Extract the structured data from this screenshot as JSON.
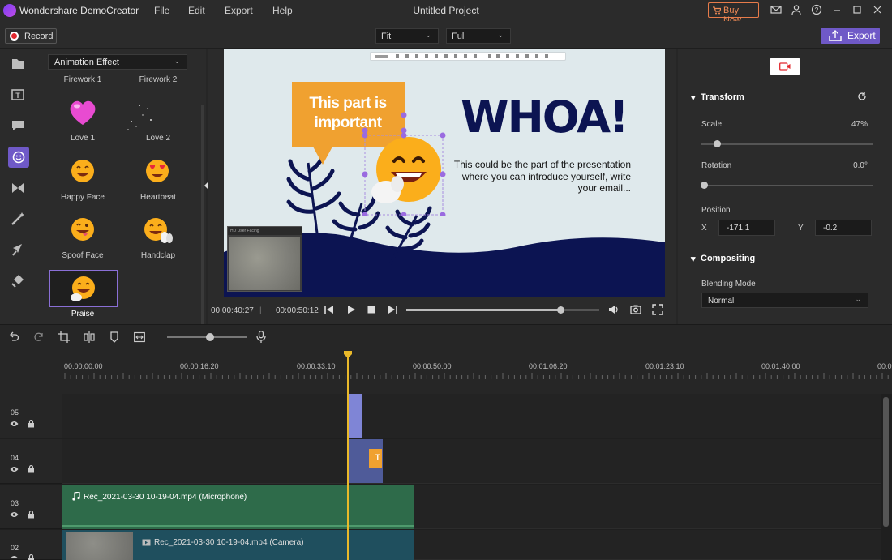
{
  "app": {
    "name": "Wondershare DemoCreator",
    "project_title": "Untitled Project",
    "menus": [
      "File",
      "Edit",
      "Export",
      "Help"
    ],
    "buy_now": "Buy Now"
  },
  "toolbar": {
    "record_label": "Record",
    "fit_value": "Fit",
    "full_value": "Full",
    "export_label": "Export"
  },
  "sidebar": {
    "icons": [
      "media-icon",
      "text-icon",
      "annotation-icon",
      "sticker-icon",
      "transition-icon",
      "effects-icon",
      "cursor-icon",
      "audio-icon"
    ],
    "active_index": 3
  },
  "effects_panel": {
    "category": "Animation Effect",
    "items": [
      {
        "label": "Firework 1"
      },
      {
        "label": "Firework 2"
      },
      {
        "label": "Love 1"
      },
      {
        "label": "Love 2"
      },
      {
        "label": "Happy Face"
      },
      {
        "label": "Heartbeat"
      },
      {
        "label": "Spoof Face"
      },
      {
        "label": "Handclap"
      },
      {
        "label": "Praise"
      }
    ],
    "selected": "Praise"
  },
  "canvas": {
    "callout": "This part is important",
    "headline": "WHOA!",
    "body": "This could be the part of the presentation where you can introduce yourself, write your email...",
    "webcam_title": "HD User Facing"
  },
  "playback": {
    "current_time": "00:00:40:27",
    "total_time": "00:00:50:12",
    "progress": 0.8
  },
  "properties": {
    "transform_label": "Transform",
    "scale_label": "Scale",
    "scale_value": "47%",
    "rotation_label": "Rotation",
    "rotation_value": "0.0°",
    "position_label": "Position",
    "x_label": "X",
    "x_value": "-171.1",
    "y_label": "Y",
    "y_value": "-0.2",
    "compositing_label": "Compositing",
    "blend_label": "Blending Mode",
    "blend_value": "Normal"
  },
  "timeline": {
    "ruler": [
      "00:00:00:00",
      "00:00:16:20",
      "00:00:33:10",
      "00:00:50:00",
      "00:01:06:20",
      "00:01:23:10",
      "00:01:40:00",
      "00:0"
    ],
    "tracks": [
      {
        "number": "05"
      },
      {
        "number": "04",
        "clip_text": "T"
      },
      {
        "number": "03",
        "clip_label": "Rec_2021-03-30 10-19-04.mp4 (Microphone)"
      },
      {
        "number": "02",
        "clip_label": "Rec_2021-03-30 10-19-04.mp4 (Camera)"
      }
    ]
  },
  "colors": {
    "accent": "#6f59c7",
    "record_red": "#e2282e",
    "buy_orange": "#f08a55",
    "playhead": "#e9b92a",
    "audio_clip": "#2e6b4a",
    "video_clip": "#1f4f5e",
    "navy": "#0c1452",
    "callout_orange": "#f0a130"
  }
}
